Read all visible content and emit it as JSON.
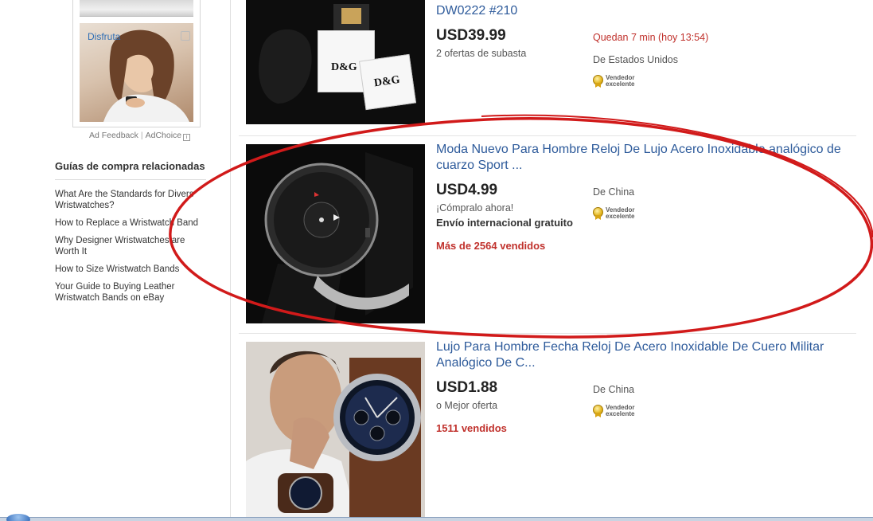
{
  "ad": {
    "label": "Disfruta",
    "feedback": "Ad Feedback",
    "separator": "|",
    "adchoice": "AdChoice"
  },
  "guides": {
    "title": "Guías de compra relacionadas",
    "items": [
      "What Are the Standards for Divers Wristwatches?",
      "How to Replace a Wristwatch Band",
      "Why Designer Wristwatches are Worth It",
      "How to Size Wristwatch Bands",
      "Your Guide to Buying Leather Wristwatch Bands on eBay"
    ]
  },
  "listings": [
    {
      "title": "DW0222 #210",
      "price": "USD39.99",
      "sub": "2 ofertas de subasta",
      "time_left": "Quedan 7 min (hoy 13:54)",
      "origin": "De Estados Unidos",
      "badge": "Vendedor excelente",
      "image_brand": "D&G"
    },
    {
      "title": "Moda Nuevo Para Hombre Reloj De Lujo Acero Inoxidable analógico de cuarzo Sport ...",
      "price": "USD4.99",
      "sub": "¡Cómpralo ahora!",
      "shipping": "Envío internacional gratuito",
      "sold": "Más de 2564 vendidos",
      "origin": "De China",
      "badge": "Vendedor excelente"
    },
    {
      "title": "Lujo Para Hombre Fecha Reloj De Acero Inoxidable De Cuero Militar Analógico De C...",
      "price": "USD1.88",
      "sub": "o Mejor oferta",
      "sold": "1511 vendidos",
      "origin": "De China",
      "badge": "Vendedor excelente"
    }
  ],
  "colors": {
    "link": "#2e5b9b",
    "alert": "#c0312c",
    "annotation": "#d11a1a"
  }
}
